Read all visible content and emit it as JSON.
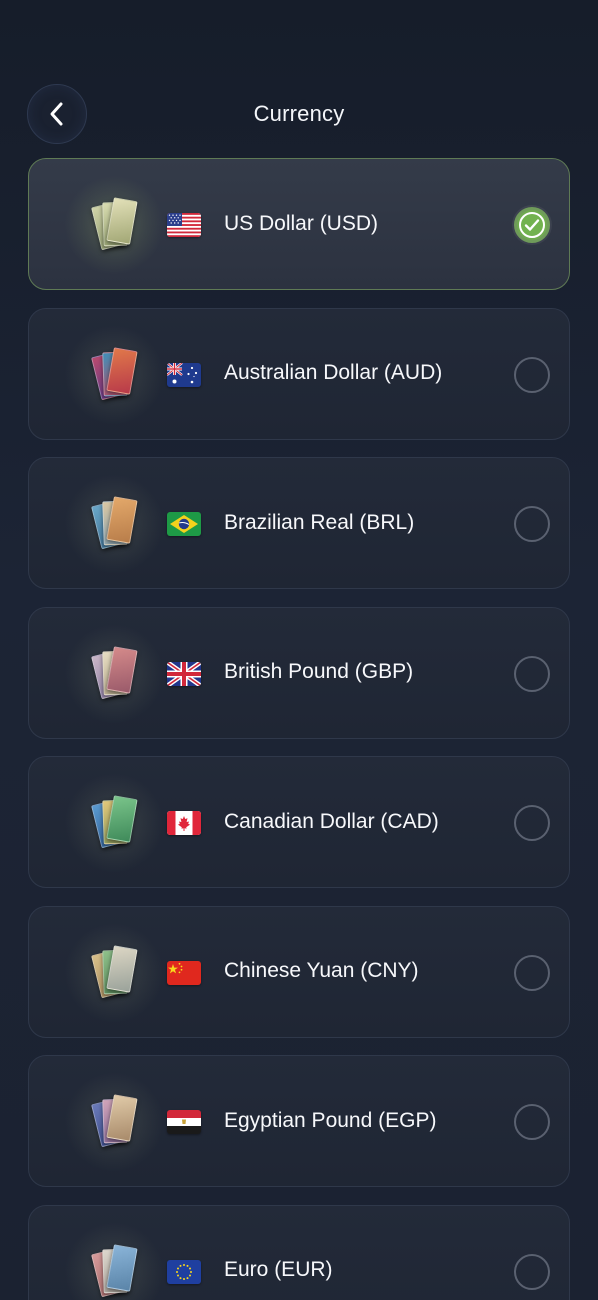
{
  "header": {
    "title": "Currency",
    "back_icon": "chevron-left-icon"
  },
  "currencies": [
    {
      "code": "USD",
      "label": "US Dollar (USD)",
      "flag": "us-flag-icon",
      "selected": true
    },
    {
      "code": "AUD",
      "label": "Australian Dollar (AUD)",
      "flag": "au-flag-icon",
      "selected": false
    },
    {
      "code": "BRL",
      "label": "Brazilian Real (BRL)",
      "flag": "br-flag-icon",
      "selected": false
    },
    {
      "code": "GBP",
      "label": "British Pound (GBP)",
      "flag": "gb-flag-icon",
      "selected": false
    },
    {
      "code": "CAD",
      "label": "Canadian Dollar (CAD)",
      "flag": "ca-flag-icon",
      "selected": false
    },
    {
      "code": "CNY",
      "label": "Chinese Yuan (CNY)",
      "flag": "cn-flag-icon",
      "selected": false
    },
    {
      "code": "EGP",
      "label": "Egyptian Pound (EGP)",
      "flag": "eg-flag-icon",
      "selected": false
    },
    {
      "code": "EUR",
      "label": "Euro (EUR)",
      "flag": "eu-flag-icon",
      "selected": false
    }
  ],
  "colors": {
    "background": "#1b2232",
    "card": "#222938",
    "card_selected": "#303746",
    "accent_green": "#6faa4f",
    "radio_border": "#5a6170"
  }
}
